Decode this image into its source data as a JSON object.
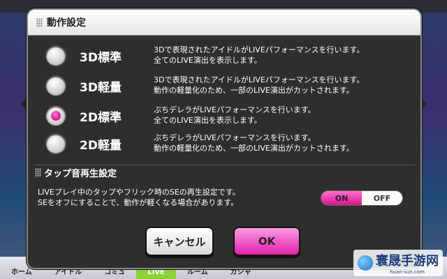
{
  "background": {
    "nav_items": [
      "ホーム",
      "アイドル",
      "コミュ",
      "LIVE",
      "ルーム",
      "ガシャ"
    ],
    "active_nav": "LIVE"
  },
  "dialog": {
    "title": "動作設定",
    "options": [
      {
        "label": "3D標準",
        "desc_line1": "3Dで表現されたアイドルがLIVEパフォーマンスを行います。",
        "desc_line2": "全てのLIVE演出を表示します。",
        "selected": false
      },
      {
        "label": "3D軽量",
        "desc_line1": "3Dで表現されたアイドルがLIVEパフォーマンスを行います。",
        "desc_line2": "動作の軽量化のため、一部のLIVE演出がカットされます。",
        "selected": false
      },
      {
        "label": "2D標準",
        "desc_line1": "ぷちデレラがLIVEパフォーマンスを行います。",
        "desc_line2": "全てのLIVE演出を表示します。",
        "selected": true
      },
      {
        "label": "2D軽量",
        "desc_line1": "ぷちデレラがLIVEパフォーマンスを行います。",
        "desc_line2": "動作の軽量化のため、一部のLIVE演出がカットされます。",
        "selected": false
      }
    ],
    "tap_sound": {
      "title": "タップ音再生設定",
      "desc_line1": "LIVEプレイ中のタップやフリック時のSEの再生設定です。",
      "desc_line2": "SEをオフにすることで、動作が軽くなる場合があります。",
      "on_label": "ON",
      "off_label": "OFF",
      "value": "ON"
    },
    "cancel_label": "キャンセル",
    "ok_label": "OK"
  },
  "watermark": {
    "title": "寰晟手游网",
    "subtitle": "huan-sun.com"
  },
  "colors": {
    "accent_pink": "#e020a8",
    "dialog_bg": "#2e2e2e"
  }
}
